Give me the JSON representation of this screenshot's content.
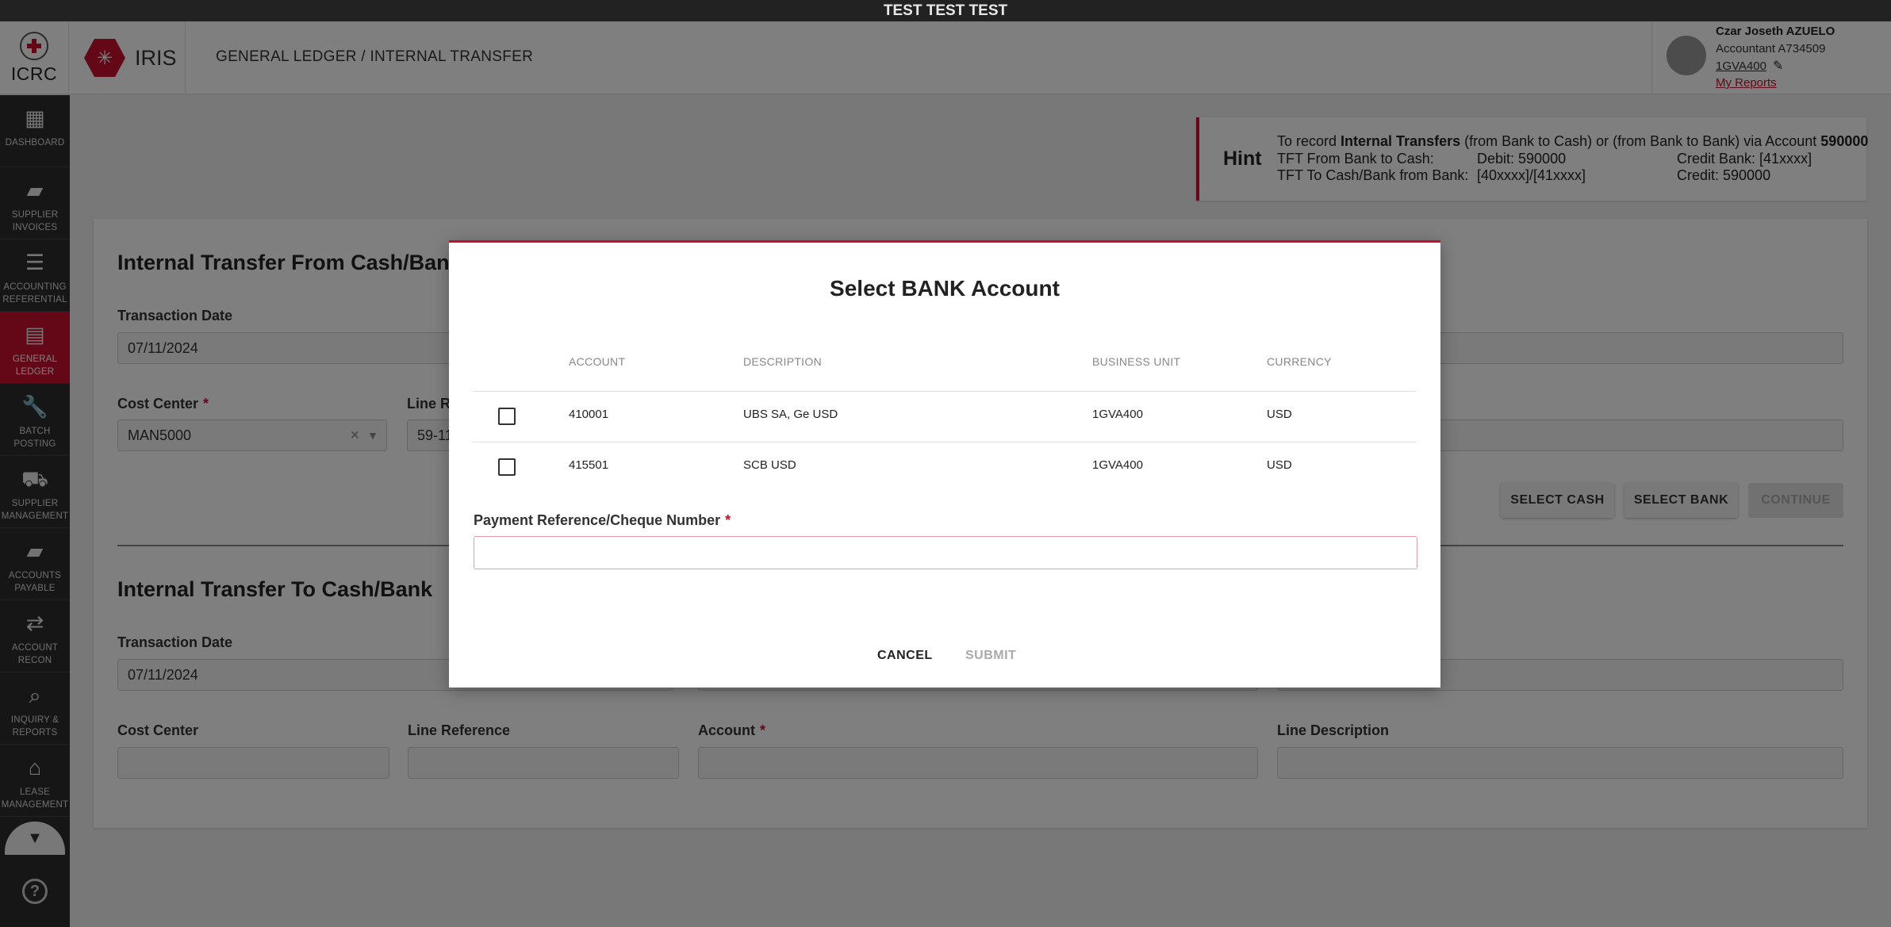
{
  "env_banner": "TEST TEST TEST",
  "header": {
    "org_name": "ICRC",
    "app_name": "IRIS",
    "breadcrumb": "GENERAL LEDGER / INTERNAL TRANSFER",
    "user": {
      "name": "Czar Joseth AZUELO",
      "role": "Accountant A734509",
      "business_unit": "1GVA400",
      "reports_link": "My Reports"
    }
  },
  "sidebar": {
    "items": [
      {
        "label": "DASHBOARD",
        "icon": "dashboard-icon"
      },
      {
        "label": "SUPPLIER INVOICES",
        "icon": "briefcase-icon"
      },
      {
        "label": "ACCOUNTING REFERENTIAL",
        "icon": "storage-icon"
      },
      {
        "label": "GENERAL LEDGER",
        "icon": "ledger-icon",
        "active": true
      },
      {
        "label": "BATCH POSTING",
        "icon": "wrench-icon"
      },
      {
        "label": "SUPPLIER MANAGEMENT",
        "icon": "truck-icon"
      },
      {
        "label": "ACCOUNTS PAYABLE",
        "icon": "briefcase-icon"
      },
      {
        "label": "ACCOUNT RECON",
        "icon": "compare-arrows-icon"
      },
      {
        "label": "INQUIRY & REPORTS",
        "icon": "search-report-icon"
      },
      {
        "label": "LEASE MANAGEMENT",
        "icon": "store-icon"
      }
    ]
  },
  "hint": {
    "title": "Hint",
    "intro_prefix": "To record ",
    "intro_bold": "Internal Transfers",
    "intro_middle": " (from Bank to Cash) or (from Bank to Bank) via Account ",
    "intro_account": "590000",
    "rows": [
      {
        "label": "TFT From Bank to Cash:",
        "debit": "Debit: 590000",
        "credit": "Credit Bank: [41xxxx]"
      },
      {
        "label": "TFT To Cash/Bank from Bank:",
        "debit": "[40xxxx]/[41xxxx]",
        "credit": "Credit: 590000"
      }
    ]
  },
  "from_section": {
    "title": "Internal Transfer From Cash/Bank",
    "transaction_date_label": "Transaction Date",
    "transaction_date": "07/11/2024",
    "cost_center_label": "Cost Center",
    "cost_center": "MAN5000",
    "line_ref_label": "Line Re",
    "line_ref": "59-11"
  },
  "actions": {
    "select_cash": "SELECT CASH",
    "select_bank": "SELECT BANK",
    "continue": "CONTINUE"
  },
  "to_section": {
    "title": "Internal Transfer To Cash/Bank",
    "transaction_date_label": "Transaction Date",
    "transaction_date": "07/11/2024",
    "cost_center_label": "Cost Center",
    "line_reference_label": "Line Reference",
    "account_label": "Account",
    "line_description_label": "Line Description"
  },
  "modal": {
    "title": "Select BANK Account",
    "columns": [
      "ACCOUNT",
      "DESCRIPTION",
      "BUSINESS UNIT",
      "CURRENCY"
    ],
    "rows": [
      {
        "account": "410001",
        "description": "UBS SA, Ge USD",
        "business_unit": "1GVA400",
        "currency": "USD"
      },
      {
        "account": "415501",
        "description": "SCB USD",
        "business_unit": "1GVA400",
        "currency": "USD"
      }
    ],
    "payment_ref_label": "Payment Reference/Cheque Number",
    "payment_ref_value": "",
    "cancel": "CANCEL",
    "submit": "SUBMIT"
  },
  "colors": {
    "brand_red": "#c8102e",
    "sidebar_bg": "#2c2c2c",
    "env_bar_bg": "#222222"
  }
}
